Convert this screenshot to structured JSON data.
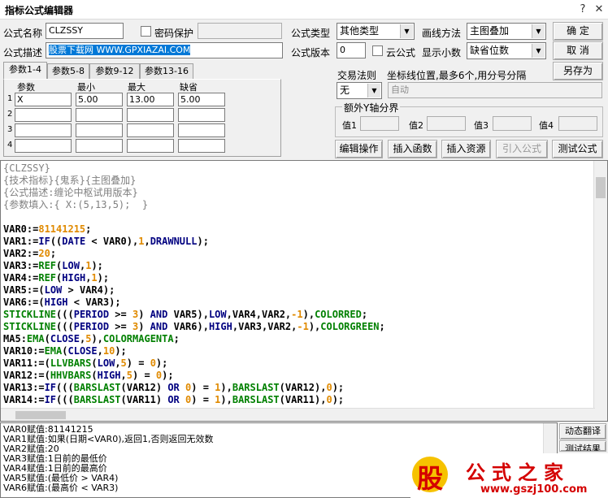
{
  "window": {
    "title": "指标公式编辑器",
    "help_glyph": "?",
    "close_glyph": "✕"
  },
  "form": {
    "name_label": "公式名称",
    "name_value": "CLZSSY",
    "password_label": "密码保护",
    "desc_label": "公式描述",
    "desc_value": "股票下载网 WWW.GPXIAZAI.COM",
    "type_label": "公式类型",
    "type_value": "其他类型",
    "version_label": "公式版本",
    "version_value": "0",
    "cloud_label": "云公式",
    "draw_label": "画线方法",
    "draw_value": "主图叠加",
    "decimals_label": "显示小数",
    "decimals_value": "缺省位数"
  },
  "buttons": {
    "ok": "确  定",
    "cancel": "取  消",
    "saveas": "另存为",
    "edit_op": "编辑操作",
    "insert_fn": "插入函数",
    "insert_res": "插入资源",
    "import_formula": "引入公式",
    "test_formula": "测试公式"
  },
  "trade": {
    "label": "交易法则",
    "value": "无",
    "coord_label": "坐标线位置,最多6个,用分号分隔",
    "coord_value": "自动"
  },
  "yaxis": {
    "title": "额外Y轴分界",
    "labels": [
      "值1",
      "值2",
      "值3",
      "值4"
    ]
  },
  "tabs": [
    "参数1-4",
    "参数5-8",
    "参数9-12",
    "参数13-16"
  ],
  "params": {
    "headers": [
      "参数",
      "最小",
      "最大",
      "缺省"
    ],
    "rows": [
      {
        "idx": "1",
        "name": "X",
        "min": "5.00",
        "max": "13.00",
        "def": "5.00"
      },
      {
        "idx": "2",
        "name": "",
        "min": "",
        "max": "",
        "def": ""
      },
      {
        "idx": "3",
        "name": "",
        "min": "",
        "max": "",
        "def": ""
      },
      {
        "idx": "4",
        "name": "",
        "min": "",
        "max": "",
        "def": ""
      }
    ]
  },
  "code": [
    "{CLZSSY}",
    "{技术指标}{鬼系}{主图叠加}",
    "{公式描述:缠论中枢试用版本}",
    "{参数填入:{ X:(5,13,5);  }",
    "",
    "VAR0:=81141215;",
    "VAR1:=IF((DATE < VAR0),1,DRAWNULL);",
    "VAR2:=20;",
    "VAR3:=REF(LOW,1);",
    "VAR4:=REF(HIGH,1);",
    "VAR5:=(LOW > VAR4);",
    "VAR6:=(HIGH < VAR3);",
    "STICKLINE(((PERIOD >= 3) AND VAR5),LOW,VAR4,VAR2,-1),COLORRED;",
    "STICKLINE(((PERIOD >= 3) AND VAR6),HIGH,VAR3,VAR2,-1),COLORGREEN;",
    "MA5:EMA(CLOSE,5),COLORMAGENTA;",
    "VAR10:=EMA(CLOSE,10);",
    "VAR11:=(LLVBARS(LOW,5) = 0);",
    "VAR12:=(HHVBARS(HIGH,5) = 0);",
    "VAR13:=IF(((BARSLAST(VAR12) OR 0) = 1),BARSLAST(VAR12),0);",
    "VAR14:=IF(((BARSLAST(VAR11) OR 0) = 1),BARSLAST(VAR11),0);"
  ],
  "output": [
    "VAR0赋值:81141215",
    "VAR1赋值:如果(日期<VAR0),返回1,否则返回无效数",
    "VAR2赋值:20",
    "VAR3赋值:1日前的最低价",
    "VAR4赋值:1日前的最高价",
    "VAR5赋值:(最低价 > VAR4)",
    "VAR6赋值:(最高价 < VAR3)"
  ],
  "side": {
    "translate": "动态翻译",
    "test_result": "测试结果"
  },
  "watermark": {
    "brand": "公式之家",
    "url": "www.gszj100.com",
    "badge": "股"
  },
  "colors": {
    "comment": "#808080",
    "keyword": "#000080",
    "function": "#008000",
    "number": "#e08a00",
    "logo_red": "#d40000"
  }
}
